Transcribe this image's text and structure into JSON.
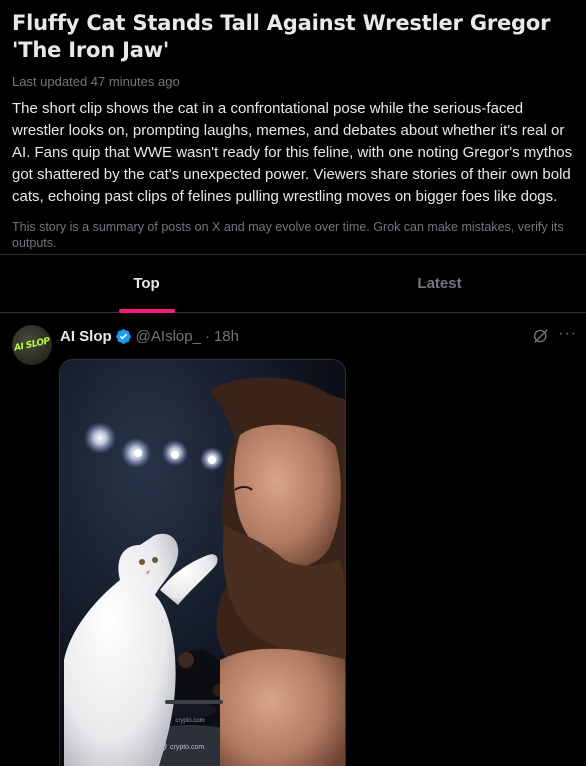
{
  "story": {
    "title": "Fluffy Cat Stands Tall Against Wrestler Gregor 'The Iron Jaw'",
    "updated": "Last updated 47 minutes ago",
    "summary": "The short clip shows the cat in a confrontational pose while the serious-faced wrestler looks on, prompting laughs, memes, and debates about whether it's real or AI. Fans quip that WWE wasn't ready for this feline, with one noting Gregor's mythos got shattered by the cat's unexpected power. Viewers share stories of their own bold cats, echoing past clips of felines pulling wrestling moves on bigger foes like dogs.",
    "disclaimer": "This story is a summary of posts on X and may evolve over time. Grok can make mistakes, verify its outputs."
  },
  "tabs": [
    {
      "label": "Top",
      "active": true
    },
    {
      "label": "Latest",
      "active": false
    }
  ],
  "post": {
    "avatar_text": "AI SLOP",
    "display_name": "AI Slop",
    "handle": "@AIslop_",
    "separator": "·",
    "time": "18h",
    "more_label": "···",
    "media": {
      "watermark": "crypto.com",
      "watermark_small": "crypto.com"
    }
  },
  "colors": {
    "accent": "#f91880",
    "verified": "#1d9bf0",
    "muted": "#71767b",
    "text": "#e7e9ea",
    "border": "#2f3336"
  },
  "icons": [
    "verified-badge-icon",
    "grok-icon",
    "more-options-icon"
  ]
}
